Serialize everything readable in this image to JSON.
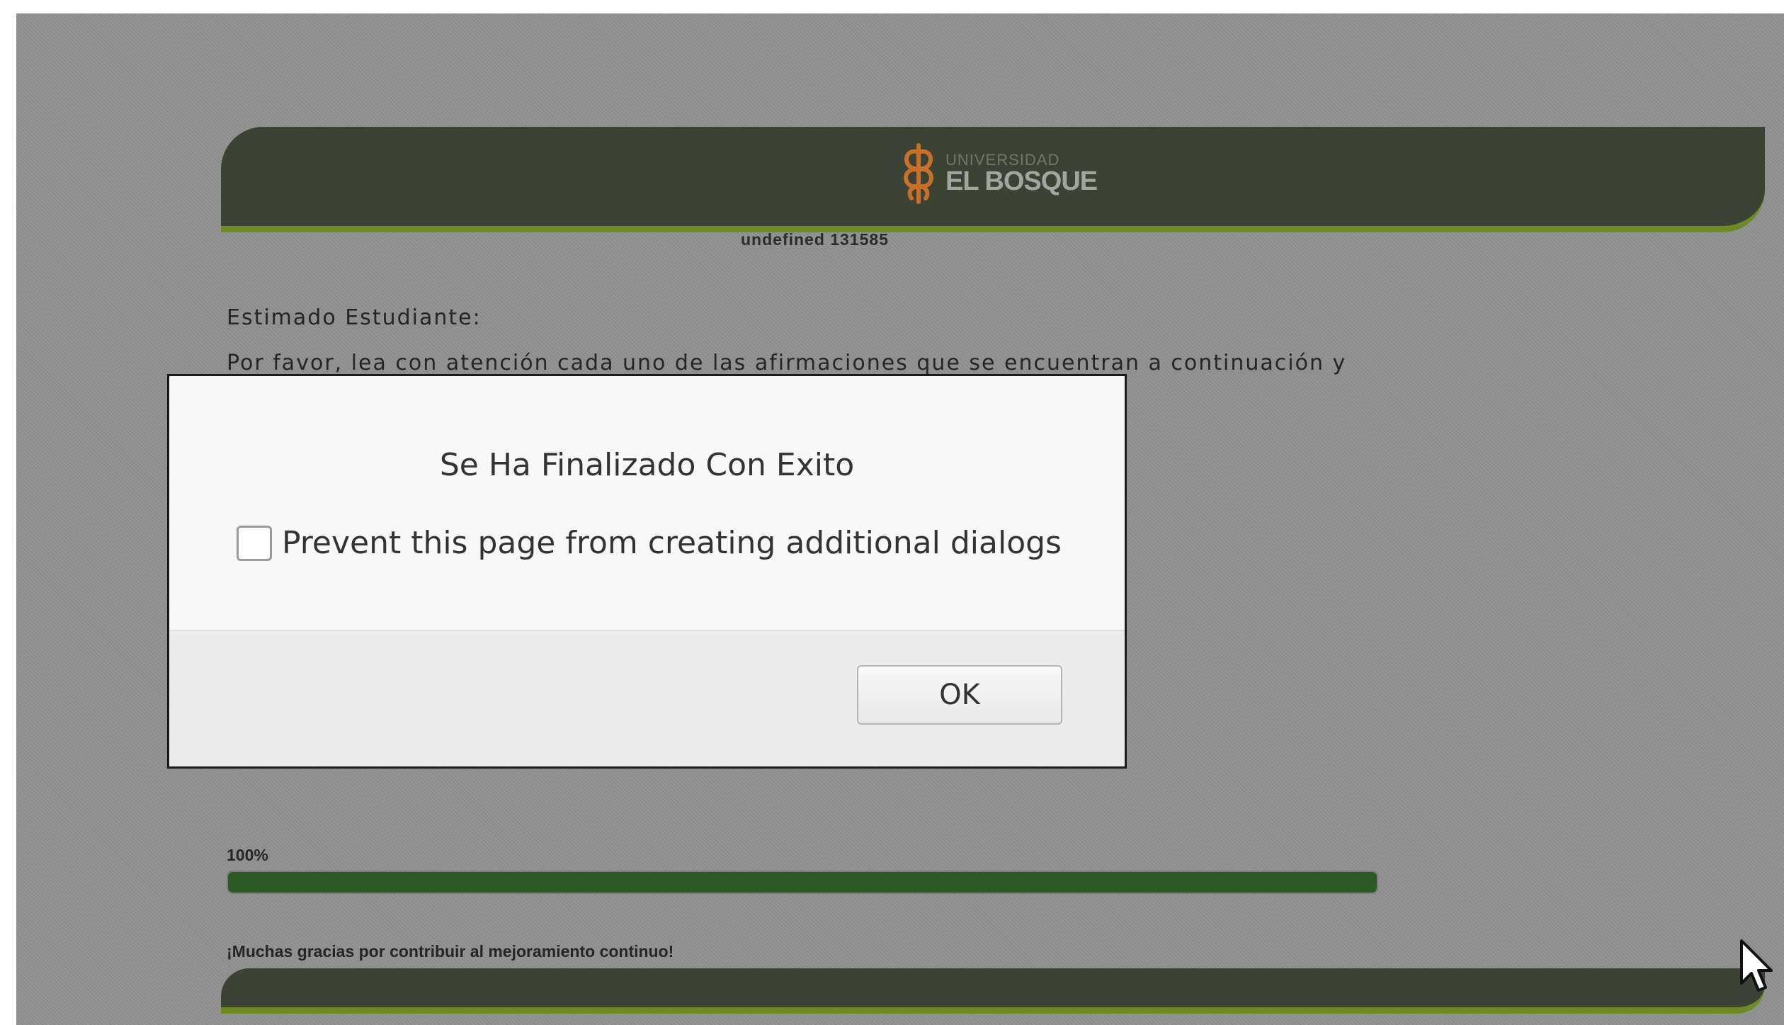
{
  "header": {
    "logo_line1": "UNIVERSIDAD",
    "logo_line2": "EL BOSQUE",
    "user_code": "undefined 131585"
  },
  "content": {
    "greeting": "Estimado Estudiante:",
    "instructions": "Por favor, lea con atención cada uno de las afirmaciones que se encuentran a continuación y"
  },
  "progress": {
    "label": "100%",
    "value": 1.0
  },
  "footer": {
    "thanks": "¡Muchas gracias por contribuir al mejoramiento continuo!"
  },
  "dialog": {
    "message": "Se Ha Finalizado Con Exito",
    "checkbox_label": "Prevent this page from creating additional dialogs",
    "checkbox_checked": false,
    "ok_label": "OK"
  },
  "colors": {
    "banner": "#3c4234",
    "banner_accent": "#6e8a25",
    "progress_fill": "#2c5a24",
    "logo_orange": "#c8702a"
  },
  "icons": {
    "logo": "university-logo-icon",
    "cursor": "mouse-pointer-icon"
  }
}
